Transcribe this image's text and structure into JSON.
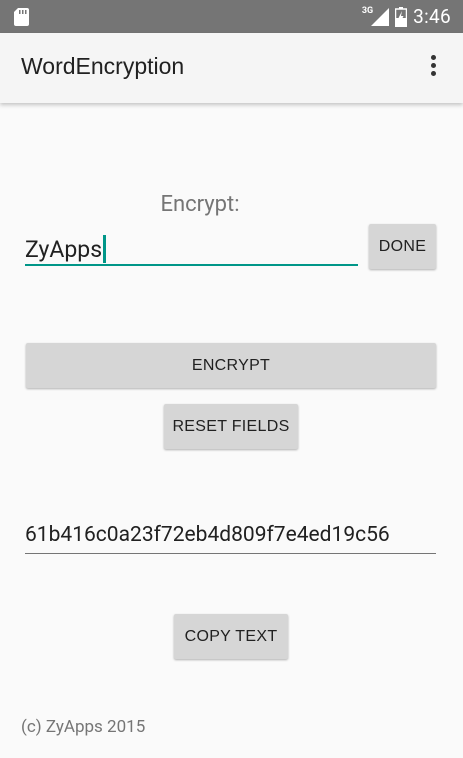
{
  "status_bar": {
    "network_type": "3G",
    "time": "3:46",
    "icons": [
      "sd-card-icon",
      "signal-icon",
      "battery-icon"
    ]
  },
  "app_bar": {
    "title": "WordEncryption",
    "menu_icon": "overflow-menu-icon"
  },
  "encrypt": {
    "label": "Encrypt:",
    "input_value": "ZyApps",
    "done_label": "DONE"
  },
  "actions": {
    "encrypt_label": "ENCRYPT",
    "reset_label": "RESET FIELDS",
    "copy_label": "COPY TEXT"
  },
  "output": {
    "value": "61b416c0a23f72eb4d809f7e4ed19c56"
  },
  "footer": {
    "text": "(c) ZyApps 2015"
  },
  "colors": {
    "accent": "#009688",
    "status_bar": "#757575",
    "button": "#d6d6d6",
    "background": "#fafafa"
  }
}
